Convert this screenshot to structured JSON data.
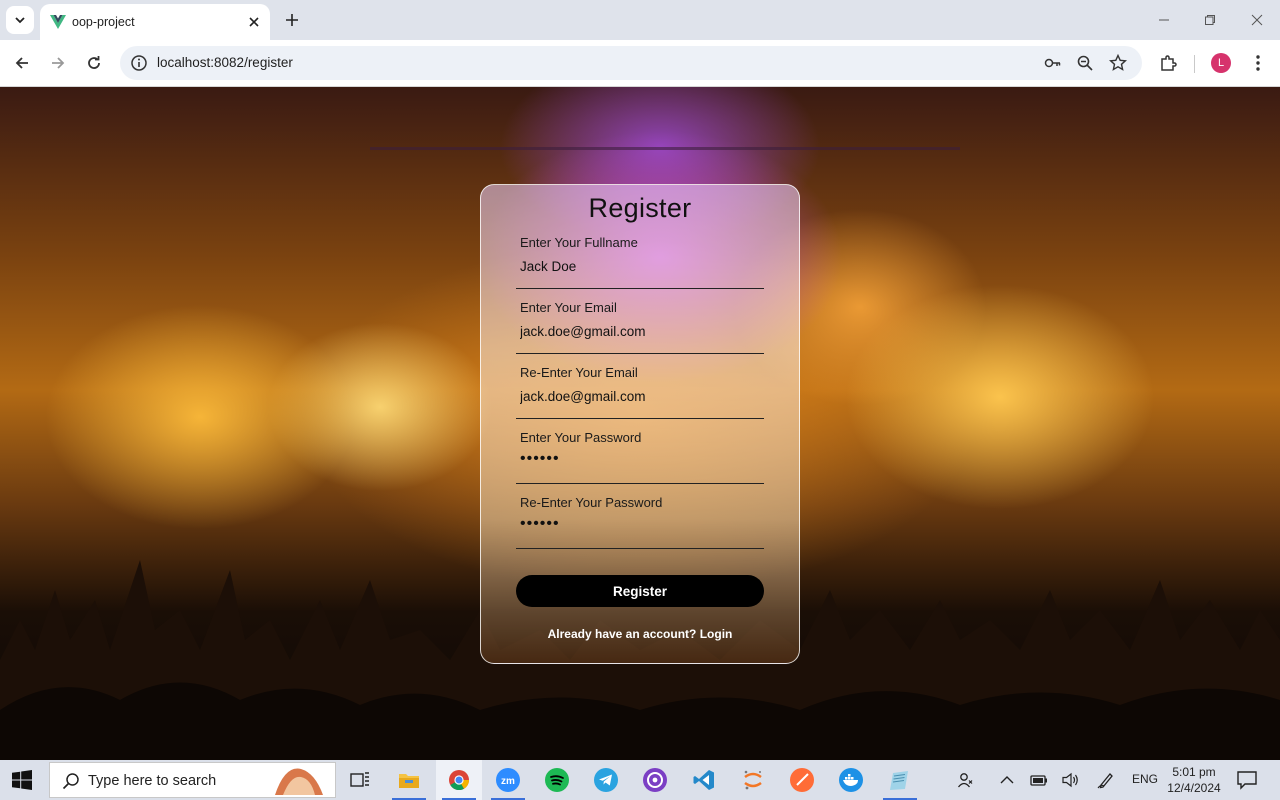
{
  "browser": {
    "tab_title": "oop-project",
    "url": "localhost:8082/register",
    "profile_initial": "L"
  },
  "register": {
    "title": "Register",
    "fields": [
      {
        "label": "Enter Your Fullname",
        "value": "Jack Doe"
      },
      {
        "label": "Enter Your Email",
        "value": "jack.doe@gmail.com"
      },
      {
        "label": "Re-Enter Your Email",
        "value": "jack.doe@gmail.com"
      },
      {
        "label": "Enter Your Password",
        "value": "••••••"
      },
      {
        "label": "Re-Enter Your Password",
        "value": "••••••"
      }
    ],
    "button_label": "Register",
    "login_prompt": "Already have an account?",
    "login_link": "Login"
  },
  "taskbar": {
    "search_placeholder": "Type here to search",
    "language": "ENG",
    "time": "5:01 pm",
    "date": "12/4/2024",
    "apps": [
      "task-view",
      "file-explorer",
      "chrome",
      "zoom",
      "spotify",
      "telegram",
      "github-desktop",
      "vscode",
      "jupyter",
      "postman",
      "docker",
      "notepad"
    ]
  }
}
